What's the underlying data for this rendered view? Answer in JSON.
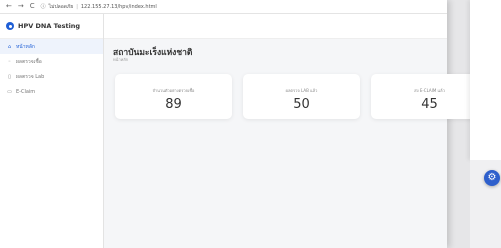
{
  "browser": {
    "back": "←",
    "forward": "→",
    "reload": "C",
    "security": "ไม่ปลอดภัย",
    "url": "122.155.27.13/hpv/index.html"
  },
  "brand": {
    "name": "HPV DNA Testing"
  },
  "sidebar": {
    "items": [
      {
        "label": "หน้าหลัก",
        "icon": "home-icon",
        "active": true
      },
      {
        "label": "ผลตรวจเชื้อ",
        "icon": "flask-icon",
        "active": false
      },
      {
        "label": "ผลตรวจ Lab",
        "icon": "document-icon",
        "active": false
      },
      {
        "label": "E-Claim",
        "icon": "card-icon",
        "active": false
      }
    ]
  },
  "page": {
    "title": "สถาบันมะเร็งแห่งชาติ",
    "subtitle": "หน้าหลัก"
  },
  "cards": [
    {
      "label": "จำนวนตัวอย่างตรวจเชื้อ",
      "value": "89"
    },
    {
      "label": "ผลตรวจ LAB แล้ว",
      "value": "50"
    },
    {
      "label": "ส่ง E-CLAIM แล้ว",
      "value": "45"
    }
  ],
  "colors": {
    "accent": "#1f5fd6",
    "fab": "#2e5fcc"
  }
}
